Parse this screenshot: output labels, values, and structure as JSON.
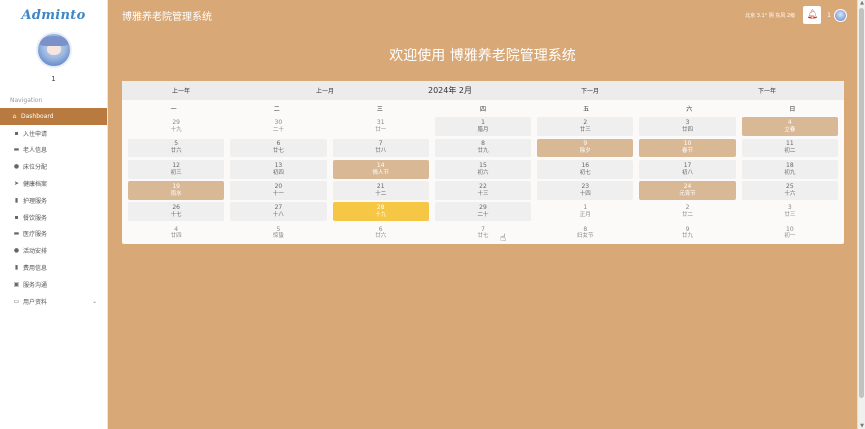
{
  "sidebar": {
    "logo": "Adminto",
    "user_name": "1",
    "nav_title": "Navigation",
    "items": [
      {
        "label": "Dashboard",
        "icon": "home-icon",
        "glyph": "⌂",
        "active": true
      },
      {
        "label": "入住申请",
        "icon": "grid-icon",
        "glyph": "▪"
      },
      {
        "label": "老人信息",
        "icon": "id-card-icon",
        "glyph": "▬"
      },
      {
        "label": "床位分配",
        "icon": "user-icon",
        "glyph": "●"
      },
      {
        "label": "健康档案",
        "icon": "send-icon",
        "glyph": "➤"
      },
      {
        "label": "护理服务",
        "icon": "bar-chart-icon",
        "glyph": "▮"
      },
      {
        "label": "餐饮服务",
        "icon": "grid-icon",
        "glyph": "▪"
      },
      {
        "label": "医疗服务",
        "icon": "id-card-icon",
        "glyph": "▬"
      },
      {
        "label": "活动安排",
        "icon": "user-icon",
        "glyph": "●"
      },
      {
        "label": "费用信息",
        "icon": "bar-chart-icon",
        "glyph": "▮"
      },
      {
        "label": "服务沟通",
        "icon": "inbox-icon",
        "glyph": "▣"
      },
      {
        "label": "用户资料",
        "icon": "document-icon",
        "glyph": "▭",
        "has_chevron": true
      }
    ]
  },
  "header": {
    "title": "博雅养老院管理系统",
    "weather": "北京  3.1°  阴  东风  2级",
    "user": "1"
  },
  "welcome": "欢迎使用 博雅养老院管理系统",
  "calendar": {
    "prev_year": "上一年",
    "prev_month": "上一月",
    "current": "2024年 2月",
    "next_month": "下一月",
    "next_year": "下一年",
    "weekdays": [
      "一",
      "二",
      "三",
      "四",
      "五",
      "六",
      "日"
    ],
    "days": [
      {
        "d": "29",
        "l": "十九",
        "t": "other"
      },
      {
        "d": "30",
        "l": "二十",
        "t": "other"
      },
      {
        "d": "31",
        "l": "廿一",
        "t": "other"
      },
      {
        "d": "1",
        "l": "腊月",
        "t": "cur"
      },
      {
        "d": "2",
        "l": "廿三",
        "t": "cur"
      },
      {
        "d": "3",
        "l": "廿四",
        "t": "cur"
      },
      {
        "d": "4",
        "l": "立春",
        "t": "hol"
      },
      {
        "d": "5",
        "l": "廿六",
        "t": "cur"
      },
      {
        "d": "6",
        "l": "廿七",
        "t": "cur"
      },
      {
        "d": "7",
        "l": "廿八",
        "t": "cur"
      },
      {
        "d": "8",
        "l": "廿九",
        "t": "cur"
      },
      {
        "d": "9",
        "l": "除夕",
        "t": "hol"
      },
      {
        "d": "10",
        "l": "春节",
        "t": "hol"
      },
      {
        "d": "11",
        "l": "初二",
        "t": "cur"
      },
      {
        "d": "12",
        "l": "初三",
        "t": "cur"
      },
      {
        "d": "13",
        "l": "初四",
        "t": "cur"
      },
      {
        "d": "14",
        "l": "情人节",
        "t": "hol"
      },
      {
        "d": "15",
        "l": "初六",
        "t": "cur"
      },
      {
        "d": "16",
        "l": "初七",
        "t": "cur"
      },
      {
        "d": "17",
        "l": "初八",
        "t": "cur"
      },
      {
        "d": "18",
        "l": "初九",
        "t": "cur"
      },
      {
        "d": "19",
        "l": "雨水",
        "t": "hol"
      },
      {
        "d": "20",
        "l": "十一",
        "t": "cur"
      },
      {
        "d": "21",
        "l": "十二",
        "t": "cur"
      },
      {
        "d": "22",
        "l": "十三",
        "t": "cur"
      },
      {
        "d": "23",
        "l": "十四",
        "t": "cur"
      },
      {
        "d": "24",
        "l": "元宵节",
        "t": "hol"
      },
      {
        "d": "25",
        "l": "十六",
        "t": "cur"
      },
      {
        "d": "26",
        "l": "十七",
        "t": "cur"
      },
      {
        "d": "27",
        "l": "十八",
        "t": "cur"
      },
      {
        "d": "28",
        "l": "十九",
        "t": "today"
      },
      {
        "d": "29",
        "l": "二十",
        "t": "cur"
      },
      {
        "d": "1",
        "l": "正月",
        "t": "other"
      },
      {
        "d": "2",
        "l": "廿二",
        "t": "other"
      },
      {
        "d": "3",
        "l": "廿三",
        "t": "other"
      },
      {
        "d": "4",
        "l": "廿四",
        "t": "other"
      },
      {
        "d": "5",
        "l": "惊蛰",
        "t": "other"
      },
      {
        "d": "6",
        "l": "廿六",
        "t": "other"
      },
      {
        "d": "7",
        "l": "廿七",
        "t": "other"
      },
      {
        "d": "8",
        "l": "妇女节",
        "t": "other"
      },
      {
        "d": "9",
        "l": "廿九",
        "t": "other"
      },
      {
        "d": "10",
        "l": "初一",
        "t": "other"
      }
    ]
  },
  "colors": {
    "background": "#d9a877",
    "active_menu": "#b97a3f",
    "holiday_cell": "#d9b896",
    "today_cell": "#f5c744"
  }
}
